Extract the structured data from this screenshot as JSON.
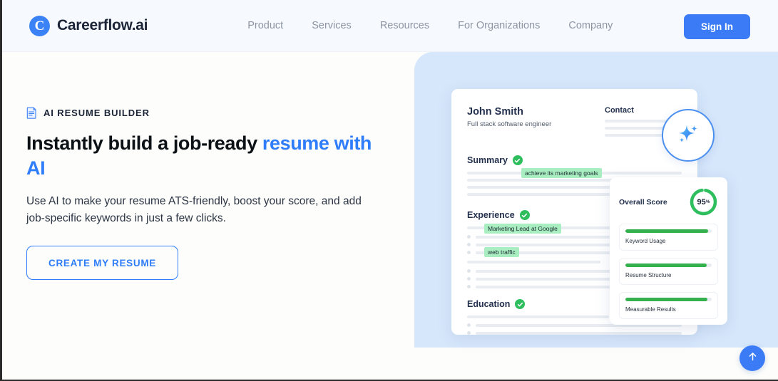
{
  "header": {
    "logo": {
      "mark": "C",
      "text": "Careerflow.ai"
    },
    "nav": [
      {
        "label": "Product"
      },
      {
        "label": "Services"
      },
      {
        "label": "Resources"
      },
      {
        "label": "For Organizations"
      },
      {
        "label": "Company"
      }
    ],
    "signin_label": "Sign In"
  },
  "hero": {
    "eyebrow": "AI RESUME BUILDER",
    "headline_plain": "Instantly build a job-ready ",
    "headline_accent": "resume with AI",
    "subcopy": "Use AI to make your resume ATS-friendly, boost your score, and add job-specific keywords in just a few clicks.",
    "cta_label": "CREATE MY RESUME",
    "accent_color": "#2f7dfa"
  },
  "resume_preview": {
    "name": "John Smith",
    "role": "Full stack software engineer",
    "contact_heading": "Contact",
    "sections": [
      {
        "title": "Summary",
        "verified": true
      },
      {
        "title": "Experience",
        "verified": true
      },
      {
        "title": "Education",
        "verified": true
      }
    ],
    "highlights": [
      {
        "text": "achieve its marketing goals"
      },
      {
        "text": "Marketing Lead at Google"
      },
      {
        "text": "web traffic"
      }
    ],
    "highlight_color": "#a8eec0",
    "badge_icon": "sparkle-icon"
  },
  "score_card": {
    "title": "Overall Score",
    "score_value": "95",
    "score_unit": "%",
    "ring_color": "#2fbe5d",
    "metrics": [
      {
        "label": "Keyword Usage",
        "percent": 96
      },
      {
        "label": "Resume Structure",
        "percent": 94
      },
      {
        "label": "Measurable Results",
        "percent": 95
      }
    ]
  },
  "floating": {
    "scroll_top_icon": "arrow-up-icon",
    "button_color": "#3b7cf6"
  }
}
